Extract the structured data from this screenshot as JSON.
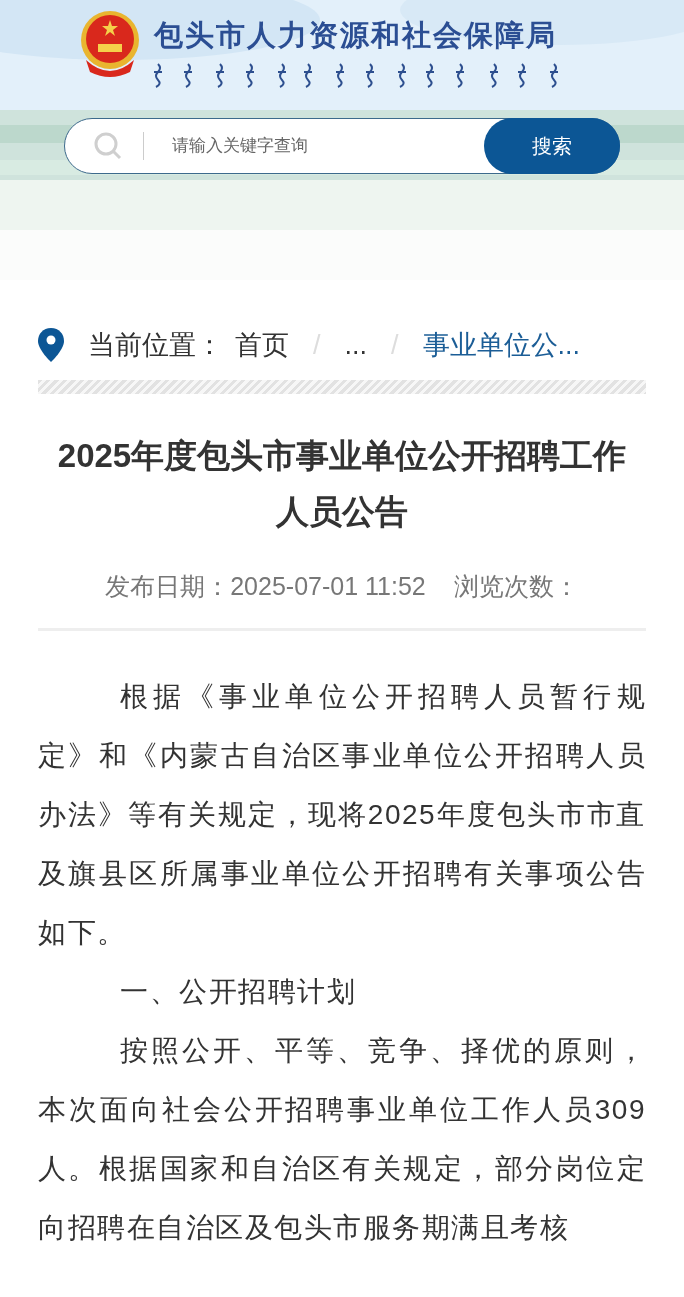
{
  "header": {
    "site_title": "包头市人力资源和社会保障局",
    "search": {
      "placeholder": "请输入关键字查询",
      "button": "搜索"
    }
  },
  "breadcrumb": {
    "label": "当前位置：",
    "separator": "/",
    "items": [
      {
        "text": "首页",
        "current": false
      },
      {
        "text": "...",
        "current": false
      },
      {
        "text": "事业单位公...",
        "current": true
      }
    ]
  },
  "article": {
    "title": "2025年度包头市事业单位公开招聘工作人员公告",
    "meta": [
      "发布日期：2025-07-01 11:52",
      "浏览次数："
    ],
    "paragraphs": [
      {
        "kind": "body",
        "text": "根据《事业单位公开招聘人员暂行规定》和《内蒙古自治区事业单位公开招聘人员办法》等有关规定，现将2025年度包头市市直及旗县区所属事业单位公开招聘有关事项公告如下。"
      },
      {
        "kind": "heading",
        "text": "一、公开招聘计划"
      },
      {
        "kind": "body",
        "text": "按照公开、平等、竞争、择优的原则，本次面向社会公开招聘事业单位工作人员309人。根据国家和自治区有关规定，部分岗位定向招聘在自治区及包头市服务期满且考核"
      }
    ]
  }
}
